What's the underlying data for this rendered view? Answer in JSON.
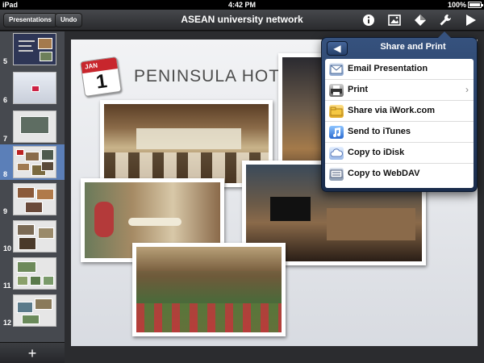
{
  "status_bar": {
    "device": "iPad",
    "time": "4:42 PM",
    "battery": "100%",
    "battery_level": 1.0
  },
  "toolbar": {
    "presentations_label": "Presentations",
    "undo_label": "Undo",
    "title": "ASEAN university network",
    "icons": [
      "info-icon",
      "media-icon",
      "shapes-icon",
      "wrench-icon",
      "play-icon"
    ]
  },
  "sidebar": {
    "slides": [
      {
        "number": "5"
      },
      {
        "number": "6"
      },
      {
        "number": "7"
      },
      {
        "number": "8",
        "selected": true
      },
      {
        "number": "9"
      },
      {
        "number": "10"
      },
      {
        "number": "11"
      },
      {
        "number": "12"
      }
    ],
    "add_label": "+"
  },
  "slide": {
    "calendar_month": "JAN",
    "calendar_day": "1",
    "title": "PENINSULA HOTEL"
  },
  "popover": {
    "title": "Share and Print",
    "back_label": "◀",
    "items": [
      {
        "label": "Email Presentation",
        "icon": "email-icon"
      },
      {
        "label": "Print",
        "icon": "printer-icon",
        "chevron": "›"
      },
      {
        "label": "Share via iWork.com",
        "icon": "folder-icon"
      },
      {
        "label": "Send to iTunes",
        "icon": "music-note-icon"
      },
      {
        "label": "Copy to iDisk",
        "icon": "cloud-icon"
      },
      {
        "label": "Copy to WebDAV",
        "icon": "network-icon"
      }
    ]
  },
  "colors": {
    "toolbar": "#2a2b2e",
    "selected_slide": "#5b7fb8",
    "popover": "#1a2c4b",
    "calendar_red": "#c8262d"
  }
}
